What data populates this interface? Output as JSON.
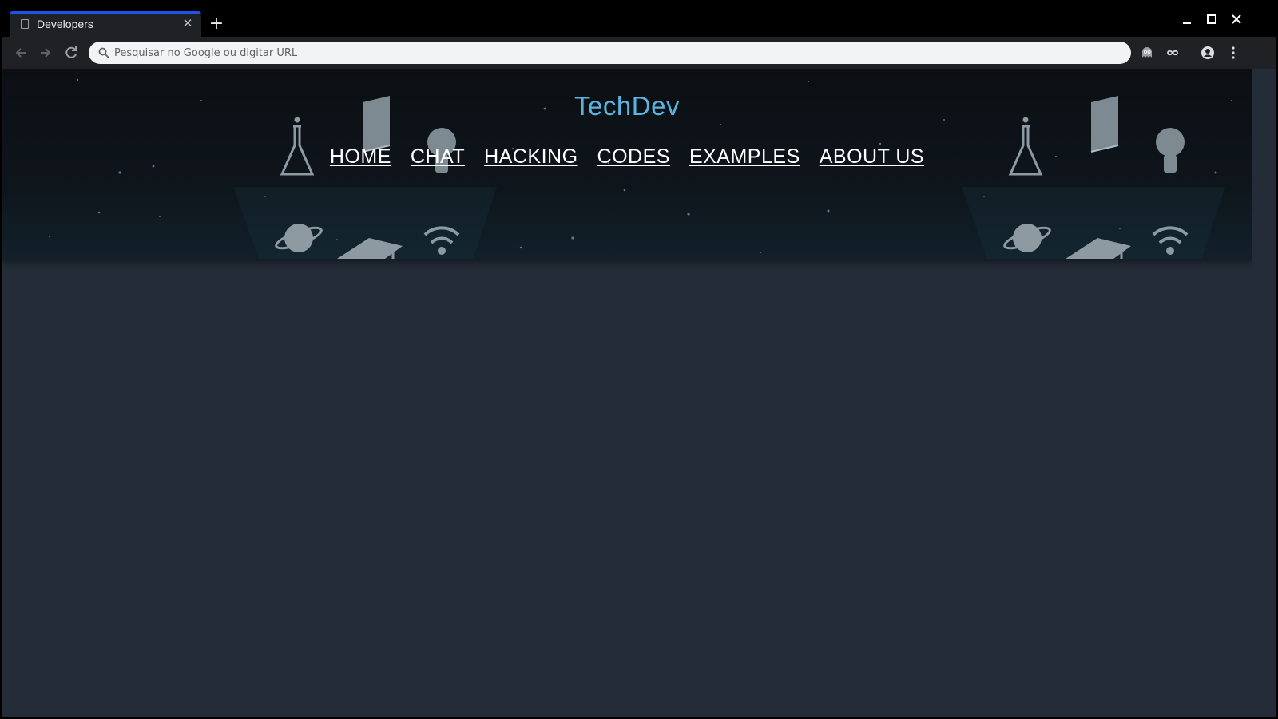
{
  "browser": {
    "tab_title": "Developers",
    "new_tab_label": "+",
    "omnibox_placeholder": "Pesquisar no Google ou digitar URL"
  },
  "site": {
    "brand": "TechDev",
    "nav": [
      "HOME",
      "CHAT",
      "HACKING",
      "CODES",
      "EXAMPLES",
      "ABOUT US"
    ]
  },
  "colors": {
    "brand": "#5bb4e0",
    "page_background": "#232c37",
    "tab_accent": "#1a55e6"
  },
  "icons": [
    "flask-icon",
    "book-icon",
    "lightbulb-icon",
    "planet-icon",
    "graduation-cap-icon",
    "wifi-icon"
  ]
}
